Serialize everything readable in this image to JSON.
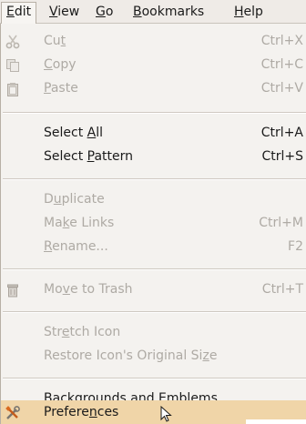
{
  "menubar": {
    "items": [
      {
        "label": "Edit",
        "mnemonic": "E",
        "rest": "dit"
      },
      {
        "label": "View",
        "mnemonic": "V",
        "rest": "iew"
      },
      {
        "label": "Go",
        "mnemonic": "G",
        "rest": "o"
      },
      {
        "label": "Bookmarks",
        "mnemonic": "B",
        "rest": "ookmarks"
      },
      {
        "label": "Help",
        "mnemonic": "H",
        "rest": "elp"
      }
    ]
  },
  "menu": {
    "items": [
      {
        "pre": "Cu",
        "mn": "t",
        "post": "",
        "accel": "Ctrl+X"
      },
      {
        "pre": "",
        "mn": "C",
        "post": "opy",
        "accel": "Ctrl+C"
      },
      {
        "pre": "",
        "mn": "P",
        "post": "aste",
        "accel": "Ctrl+V"
      },
      {
        "pre": "Select ",
        "mn": "A",
        "post": "ll",
        "accel": "Ctrl+A"
      },
      {
        "pre": "Select ",
        "mn": "P",
        "post": "attern",
        "accel": "Ctrl+S"
      },
      {
        "pre": "D",
        "mn": "u",
        "post": "plicate",
        "accel": ""
      },
      {
        "pre": "Ma",
        "mn": "k",
        "post": "e Links",
        "accel": "Ctrl+M"
      },
      {
        "pre": "",
        "mn": "R",
        "post": "ename...",
        "accel": "F2"
      },
      {
        "pre": "Mo",
        "mn": "v",
        "post": "e to Trash",
        "accel": "Ctrl+T"
      },
      {
        "pre": "Str",
        "mn": "e",
        "post": "tch Icon",
        "accel": ""
      },
      {
        "pre": "Restore Icon's Original Si",
        "mn": "z",
        "post": "e",
        "accel": ""
      },
      {
        "pre": "",
        "mn": "B",
        "post": "ackgrounds and Emblems...",
        "accel": ""
      },
      {
        "pre": "Prefere",
        "mn": "n",
        "post": "ces",
        "accel": ""
      }
    ]
  },
  "colors": {
    "menu_bg": "#f4f2ef",
    "disabled_text": "#aeaaa4",
    "highlight": "#f0d5a8"
  }
}
